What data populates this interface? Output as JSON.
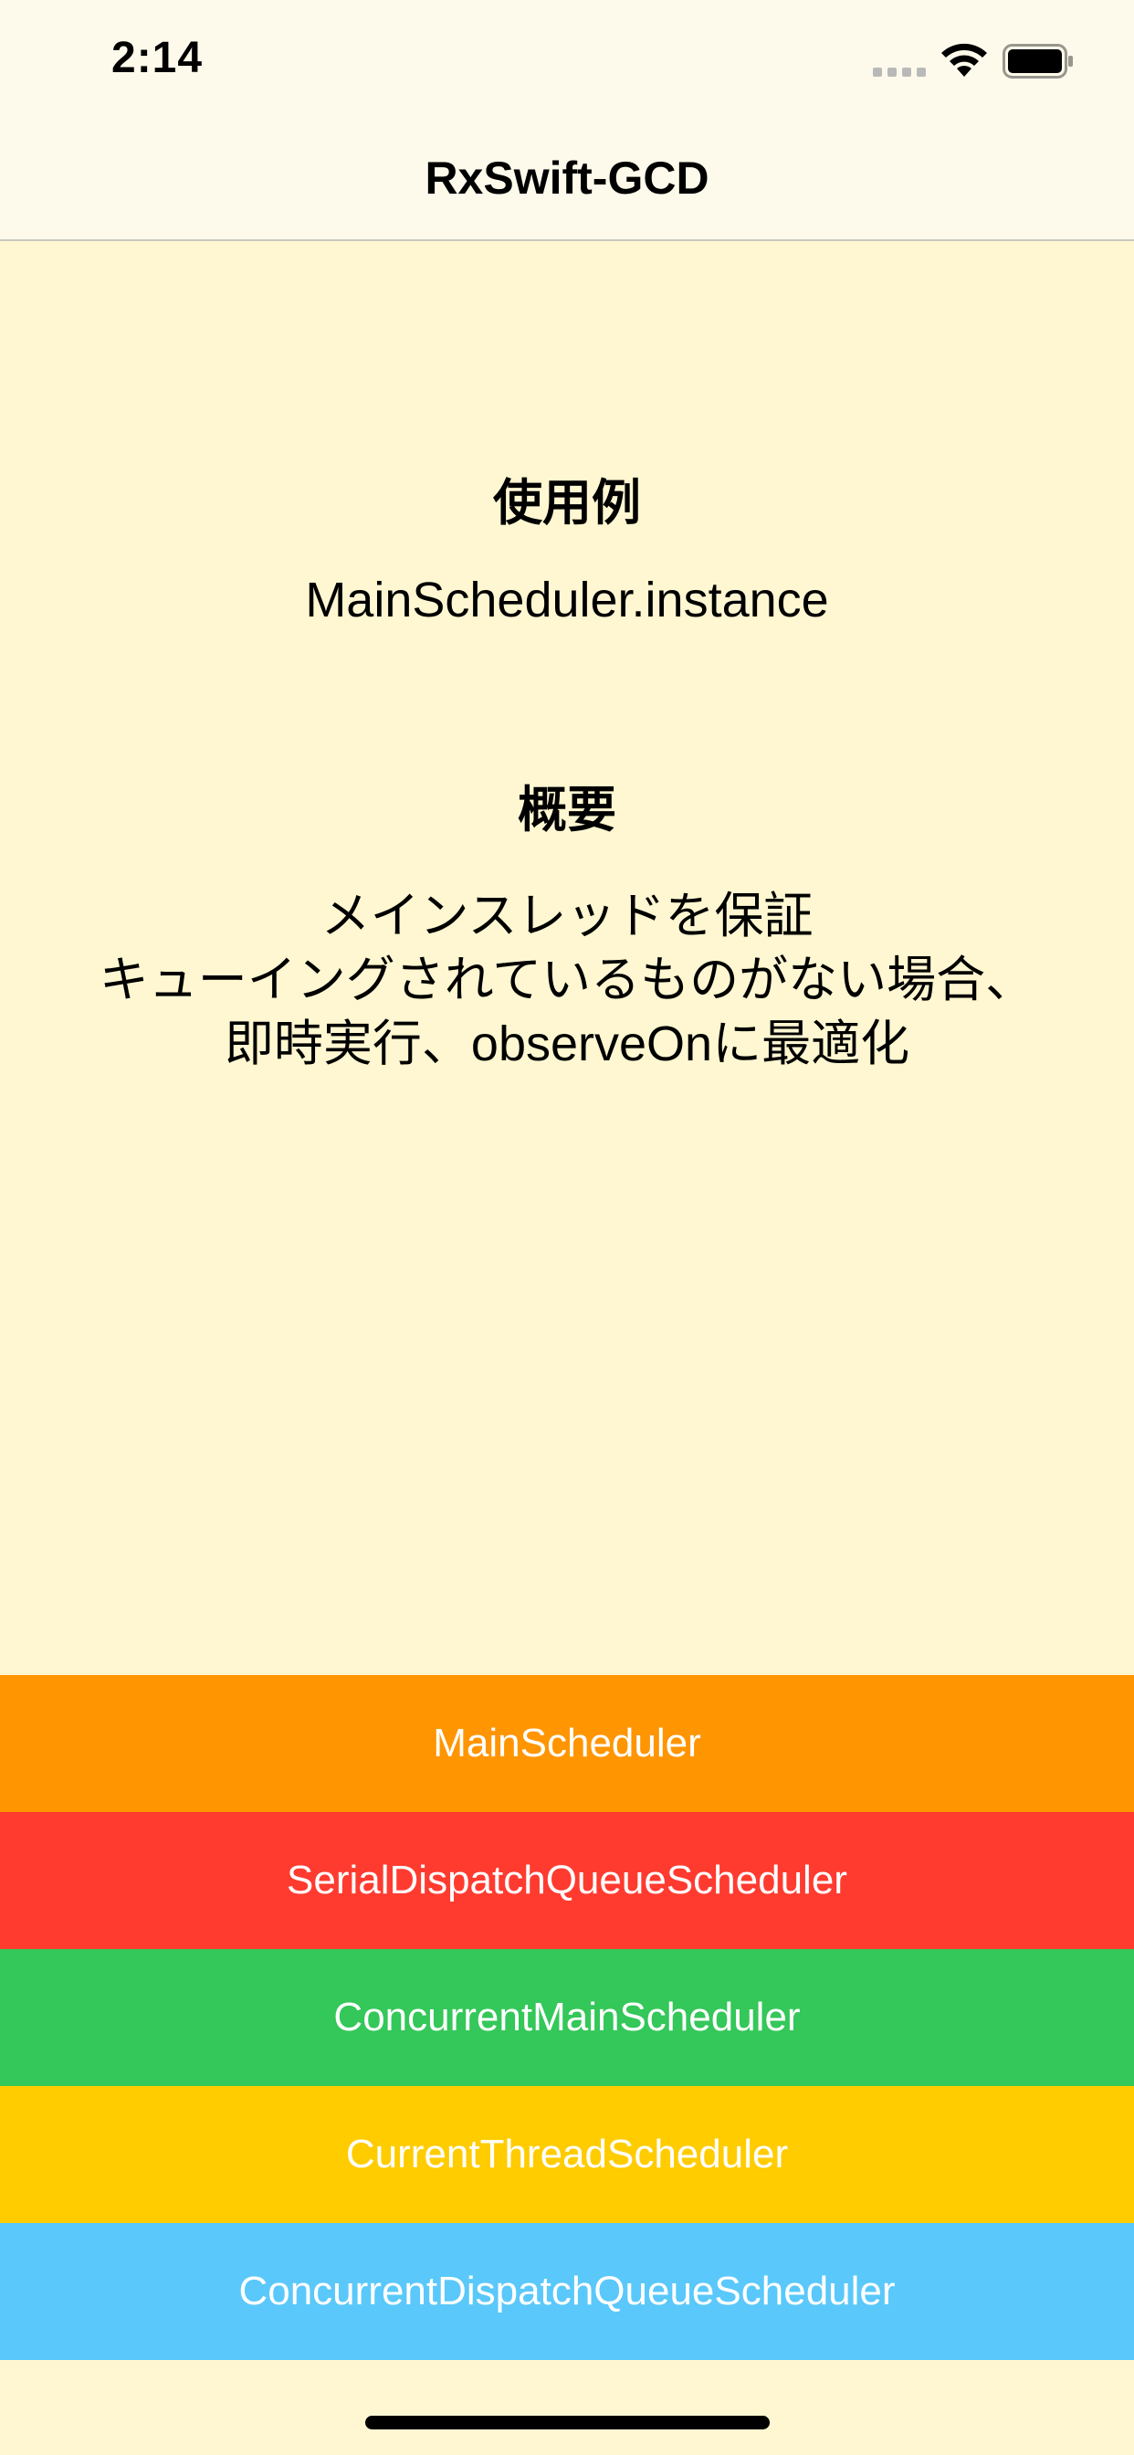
{
  "status_bar": {
    "time": "2:14",
    "icons": [
      "signal-icon",
      "wifi-icon",
      "battery-icon"
    ]
  },
  "nav": {
    "title": "RxSwift-GCD"
  },
  "usage": {
    "heading": "使用例",
    "body": "MainScheduler.instance"
  },
  "summary": {
    "heading": "概要",
    "lines": [
      "メインスレッドを保証",
      "キューイングされているものがない場合、",
      "即時実行、observeOnに最適化"
    ]
  },
  "schedulers": [
    {
      "label": "MainScheduler",
      "color": "#ff9500"
    },
    {
      "label": "SerialDispatchQueueScheduler",
      "color": "#ff3b30"
    },
    {
      "label": "ConcurrentMainScheduler",
      "color": "#34c759"
    },
    {
      "label": "CurrentThreadScheduler",
      "color": "#ffcc00"
    },
    {
      "label": "ConcurrentDispatchQueueScheduler",
      "color": "#5ac8fa"
    }
  ],
  "colors": {
    "background": "#fef7d1",
    "bar_background": "#fefaeb"
  }
}
